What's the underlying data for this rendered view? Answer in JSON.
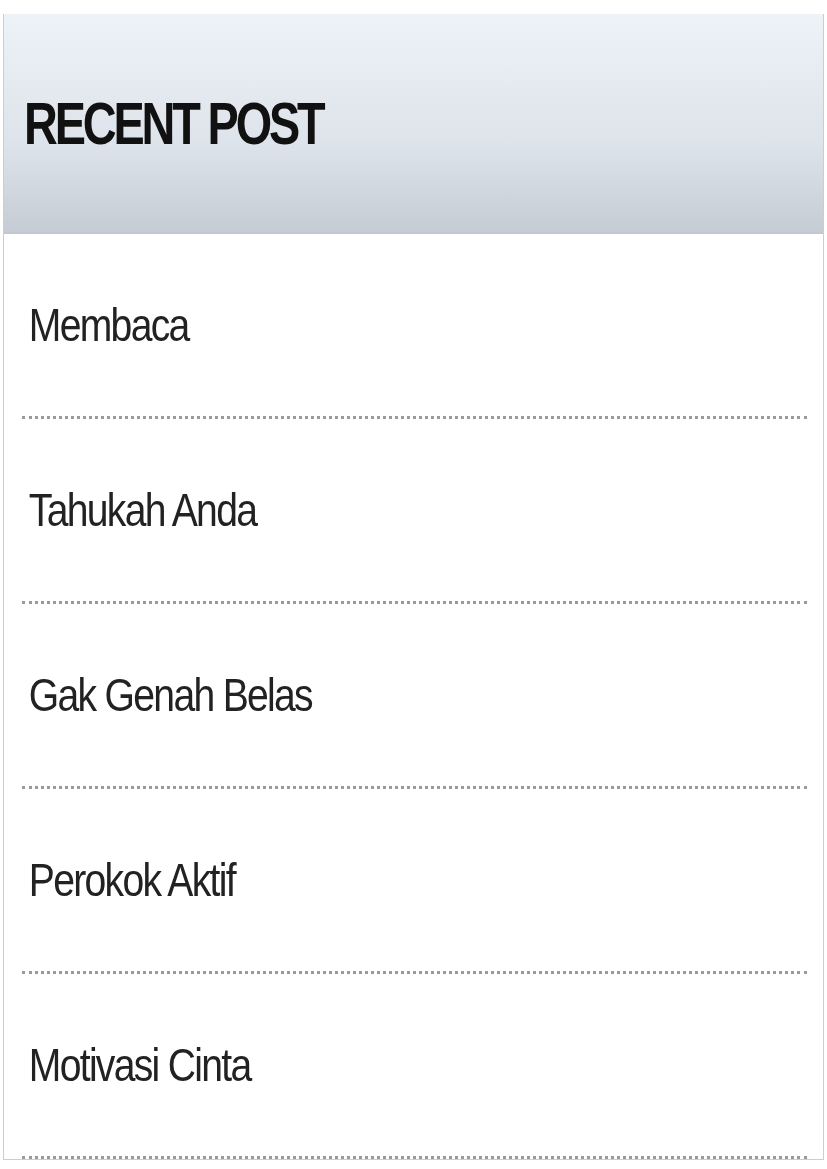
{
  "widget": {
    "title": "RECENT POST",
    "posts": [
      {
        "title": "Membaca"
      },
      {
        "title": "Tahukah Anda"
      },
      {
        "title": "Gak Genah Belas"
      },
      {
        "title": "Perokok Aktif"
      },
      {
        "title": "Motivasi Cinta"
      }
    ]
  }
}
